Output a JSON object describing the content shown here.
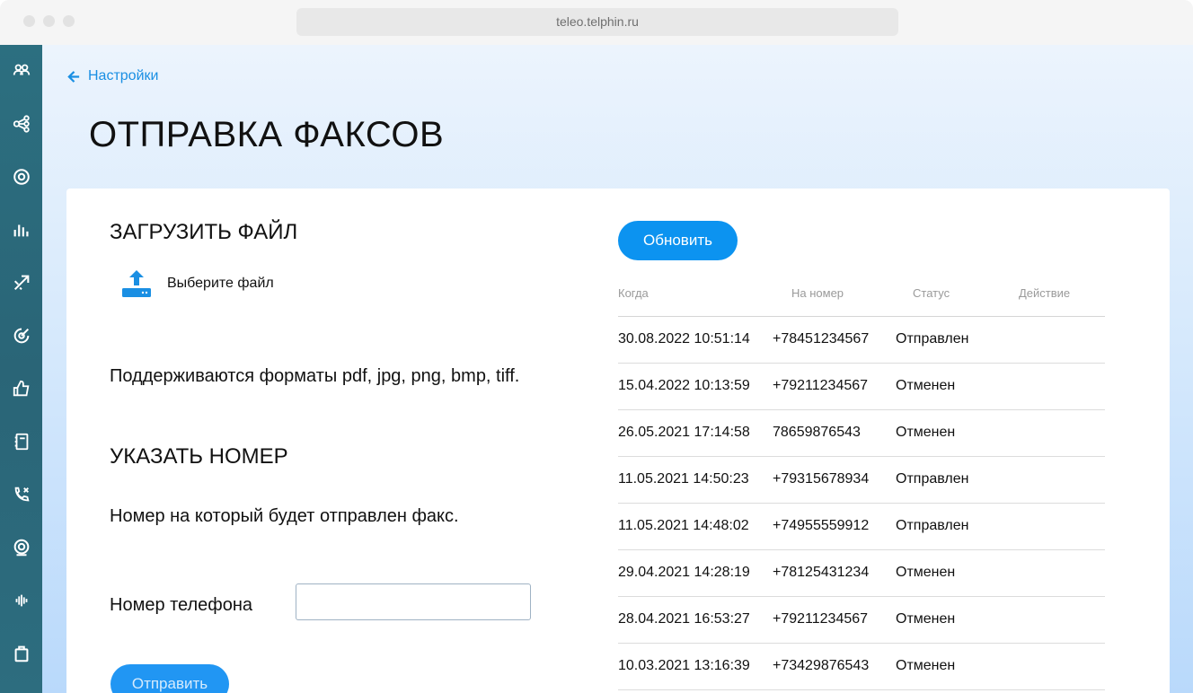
{
  "browser": {
    "url": "teleo.telphin.ru"
  },
  "sidebar": {
    "icons": [
      "users-icon",
      "flow-icon",
      "settings-icon",
      "stats-icon",
      "routing-icon",
      "target-icon",
      "like-icon",
      "notebook-icon",
      "call-forward-icon",
      "webcam-icon",
      "voice-icon",
      "store-icon"
    ]
  },
  "header": {
    "back_label": "Настройки",
    "title": "ОТПРАВКА ФАКСОВ"
  },
  "upload": {
    "title": "ЗАГРУЗИТЬ ФАЙЛ",
    "choose_label": "Выберите файл",
    "formats_text": "Поддерживаются форматы pdf, jpg, png, bmp, tiff."
  },
  "number": {
    "title": "УКАЗАТЬ НОМЕР",
    "description": "Номер на который будет отправлен факс.",
    "phone_label": "Номер телефона",
    "phone_value": ""
  },
  "actions": {
    "send_label": "Отправить",
    "refresh_label": "Обновить"
  },
  "table": {
    "headers": {
      "when": "Когда",
      "number": "На номер",
      "status": "Статус",
      "action": "Действие"
    },
    "rows": [
      {
        "when": "30.08.2022 10:51:14",
        "number": "+78451234567",
        "status": "Отправлен"
      },
      {
        "when": "15.04.2022 10:13:59",
        "number": "+79211234567",
        "status": "Отменен"
      },
      {
        "when": "26.05.2021 17:14:58",
        "number": "78659876543",
        "status": "Отменен"
      },
      {
        "when": "11.05.2021 14:50:23",
        "number": "+79315678934",
        "status": "Отправлен"
      },
      {
        "when": "11.05.2021 14:48:02",
        "number": "+74955559912",
        "status": "Отправлен"
      },
      {
        "when": "29.04.2021 14:28:19",
        "number": "+78125431234",
        "status": "Отменен"
      },
      {
        "when": "28.04.2021 16:53:27",
        "number": "+79211234567",
        "status": "Отменен"
      },
      {
        "when": "10.03.2021 13:16:39",
        "number": "+73429876543",
        "status": "Отменен"
      }
    ]
  },
  "colors": {
    "accent": "#0c93f0",
    "link": "#1a8fe3",
    "sidebar": "#2a6577"
  }
}
